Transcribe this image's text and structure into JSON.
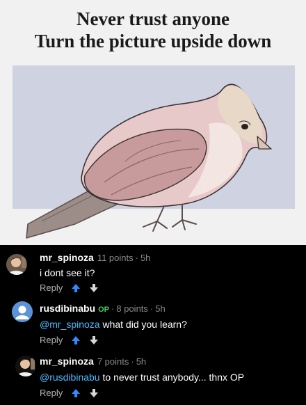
{
  "meme": {
    "title_line1": "Never trust anyone",
    "title_line2": "Turn the picture upside down"
  },
  "comments": [
    {
      "username": "mr_spinoza",
      "is_op": false,
      "points": "11 points",
      "separator": "·",
      "time": "5h",
      "mention": "",
      "text": "i dont see it?",
      "reply_label": "Reply"
    },
    {
      "username": "rusdibinabu",
      "is_op": true,
      "op_label": "OP",
      "points": "8 points",
      "separator": "·",
      "time": "5h",
      "mention": "@mr_spinoza",
      "text": " what did you learn?",
      "reply_label": "Reply"
    },
    {
      "username": "mr_spinoza",
      "is_op": false,
      "points": "7 points",
      "separator": "·",
      "time": "5h",
      "mention": "@rusdibinabu",
      "text": " to never trust anybody... thnx OP",
      "reply_label": "Reply"
    }
  ],
  "colors": {
    "upvote": "#2f8cff",
    "mention": "#4fbcff",
    "op_badge": "#46d160",
    "default_avatar": "#5b93d9"
  },
  "icons": {
    "upvote": "arrow-up-icon",
    "downvote": "arrow-down-icon",
    "default_avatar": "user-silhouette-icon"
  }
}
